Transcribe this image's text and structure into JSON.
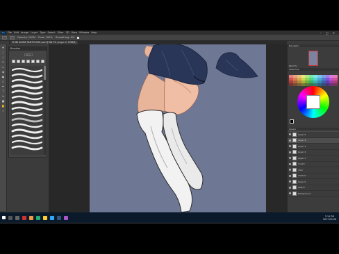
{
  "menubar": {
    "items": [
      "File",
      "Edit",
      "Image",
      "Layer",
      "Type",
      "Select",
      "Filter",
      "3D",
      "View",
      "Window",
      "Help"
    ],
    "window_controls": [
      "–",
      "□",
      "✕"
    ]
  },
  "options": {
    "opacity_label": "Opacity: 100%",
    "flow_label": "Flow: 100%",
    "smoothing_label": "Smoothing: 0%"
  },
  "document_tab": "CHIBI ANIME PANTYHOSE.psd @ 66.7% (Layer 2, RGB/8)",
  "tools": [
    "move-tool",
    "marquee-tool",
    "lasso-tool",
    "brush-tool",
    "eraser-tool",
    "bucket-tool",
    "blur-tool",
    "dodge-tool",
    "pen-tool",
    "text-tool",
    "path-select-tool",
    "shape-tool",
    "hand-tool",
    "zoom-tool"
  ],
  "brushes_panel": {
    "title": "Brushes",
    "size": "40 px"
  },
  "navigator": {
    "title": "Navigator",
    "zoom": "66.67%"
  },
  "swatches": {
    "title": "Swatches"
  },
  "layers_panel": {
    "title": "Layers",
    "layers": [
      {
        "name": "Layer 5",
        "selected": false
      },
      {
        "name": "Layer 4",
        "selected": true
      },
      {
        "name": "Layer 3",
        "selected": false
      },
      {
        "name": "Layer 2",
        "selected": false
      },
      {
        "name": "Layer 1",
        "selected": false
      },
      {
        "name": "lineart",
        "selected": false
      },
      {
        "name": "color",
        "selected": false
      },
      {
        "name": "shadow",
        "selected": false
      },
      {
        "name": "Layer 0",
        "selected": false
      },
      {
        "name": "sketch",
        "selected": false
      },
      {
        "name": "Background",
        "selected": false
      }
    ]
  },
  "status": {
    "zoom": "66.67%",
    "doc": "Doc: 22.6M/216.4M"
  },
  "taskbar": {
    "time": "3:14 PM",
    "date": "2017-09-08"
  },
  "colors": {
    "canvas_bg": "#6e7894",
    "skirt": "#2a3657",
    "skin": "#e8b49a",
    "stocking": "#f2f2f2"
  }
}
